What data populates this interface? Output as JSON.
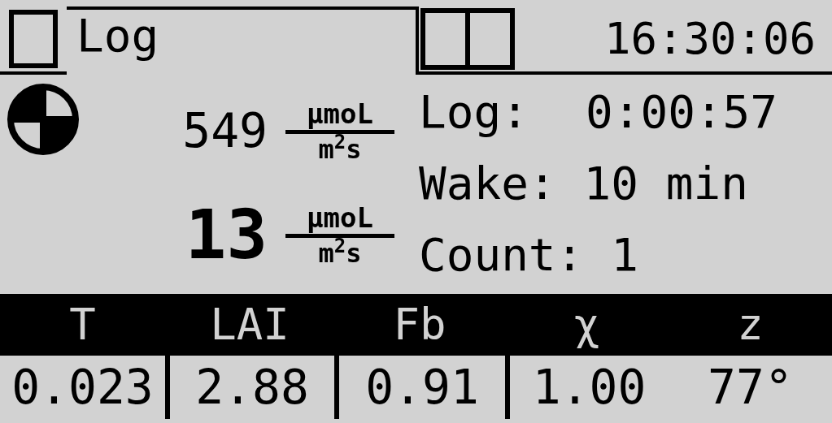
{
  "header": {
    "tabs": [
      {
        "label": "Log",
        "selected": true
      }
    ],
    "time": "16:30:06"
  },
  "readings": [
    {
      "kind": "small",
      "value": "549",
      "unit_top": "µmoL",
      "unit_bottom": "m$^{2}$s"
    },
    {
      "kind": "large",
      "value": "13",
      "unit_top": "µmoL",
      "unit_bottom": "m$^{2}$s"
    }
  ],
  "status": [
    {
      "label": "Log:",
      "value": "0:00:57"
    },
    {
      "label": "Wake:",
      "value": "10 min"
    },
    {
      "label": "Count:",
      "value": "1"
    }
  ],
  "table": {
    "columns": [
      "T",
      "LAI",
      "Fb",
      "χ",
      "z"
    ],
    "rows": [
      [
        "0.023",
        "2.88",
        "0.91",
        "1.00",
        "77°"
      ]
    ]
  }
}
